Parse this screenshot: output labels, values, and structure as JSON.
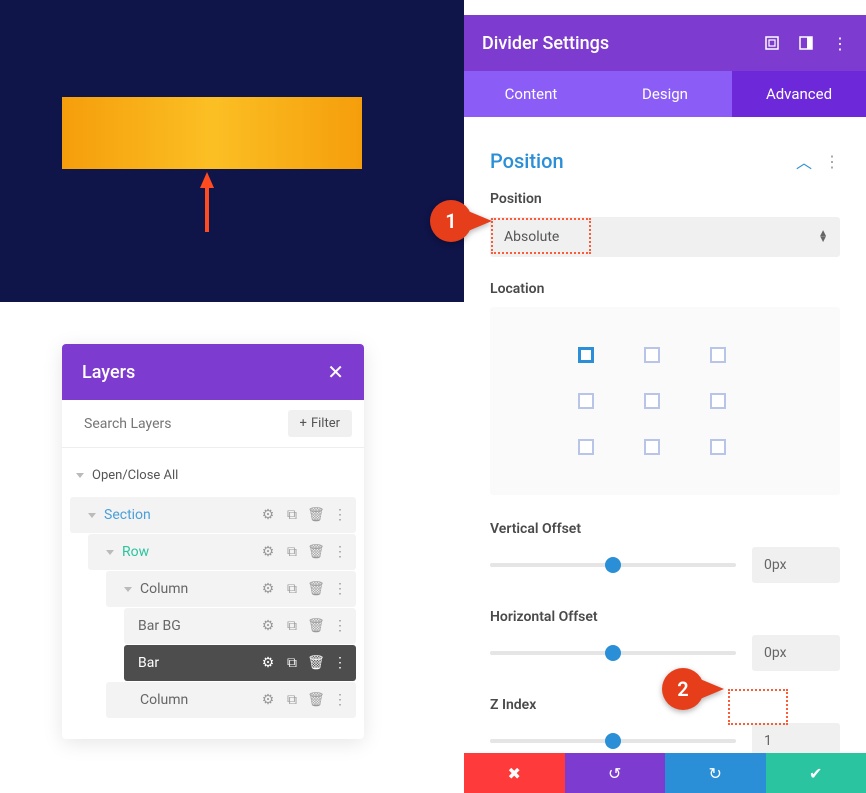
{
  "canvas": {},
  "layers": {
    "title": "Layers",
    "search_placeholder": "Search Layers",
    "filter_label": "Filter",
    "open_close_label": "Open/Close All",
    "items": {
      "section": "Section",
      "row": "Row",
      "column1": "Column",
      "bar_bg": "Bar BG",
      "bar": "Bar",
      "column2": "Column"
    }
  },
  "settings": {
    "title": "Divider Settings",
    "tabs": {
      "content": "Content",
      "design": "Design",
      "advanced": "Advanced"
    },
    "section": "Position",
    "position": {
      "label": "Position",
      "value": "Absolute"
    },
    "location": {
      "label": "Location"
    },
    "vertical_offset": {
      "label": "Vertical Offset",
      "value": "0px"
    },
    "horizontal_offset": {
      "label": "Horizontal Offset",
      "value": "0px"
    },
    "z_index": {
      "label": "Z Index",
      "value": "1"
    }
  },
  "callouts": {
    "one": "1",
    "two": "2"
  }
}
